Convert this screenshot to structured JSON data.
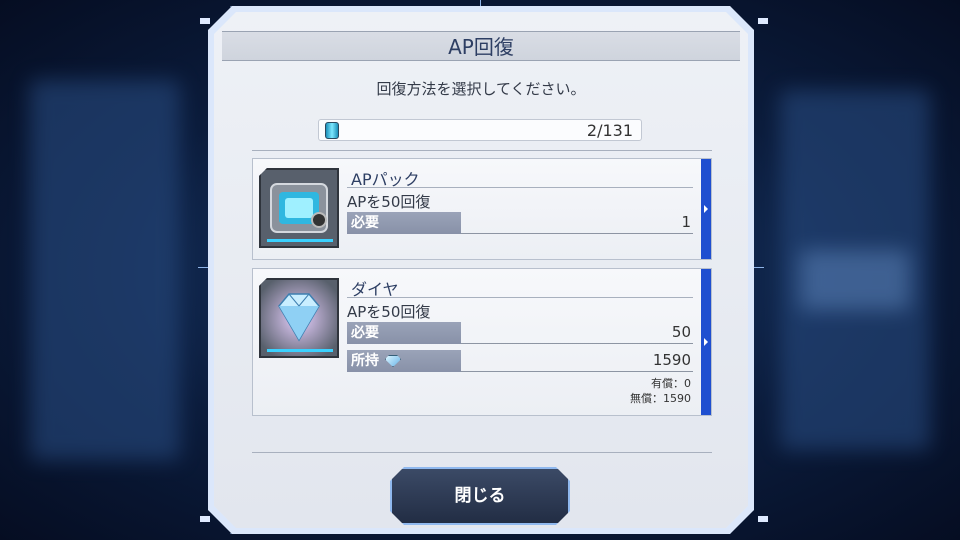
{
  "dialog": {
    "title": "AP回復",
    "subtitle": "回復方法を選択してください。",
    "ap_current": "2/131"
  },
  "options": [
    {
      "name": "APパック",
      "description": "APを50回復",
      "required_label": "必要",
      "required_value": "1",
      "thumbnail_icon": "ap-pack-icon"
    },
    {
      "name": "ダイヤ",
      "description": "APを50回復",
      "required_label": "必要",
      "required_value": "50",
      "owned_label": "所持",
      "owned_value": "1590",
      "paid_note": "有償：0",
      "free_note": "無償：1590",
      "thumbnail_icon": "diamond-icon"
    }
  ],
  "footer": {
    "close_label": "閉じる"
  },
  "colors": {
    "accent_tab": "#1f4fd0",
    "title_text": "#2d3e63",
    "background": "#0b1c3c"
  }
}
